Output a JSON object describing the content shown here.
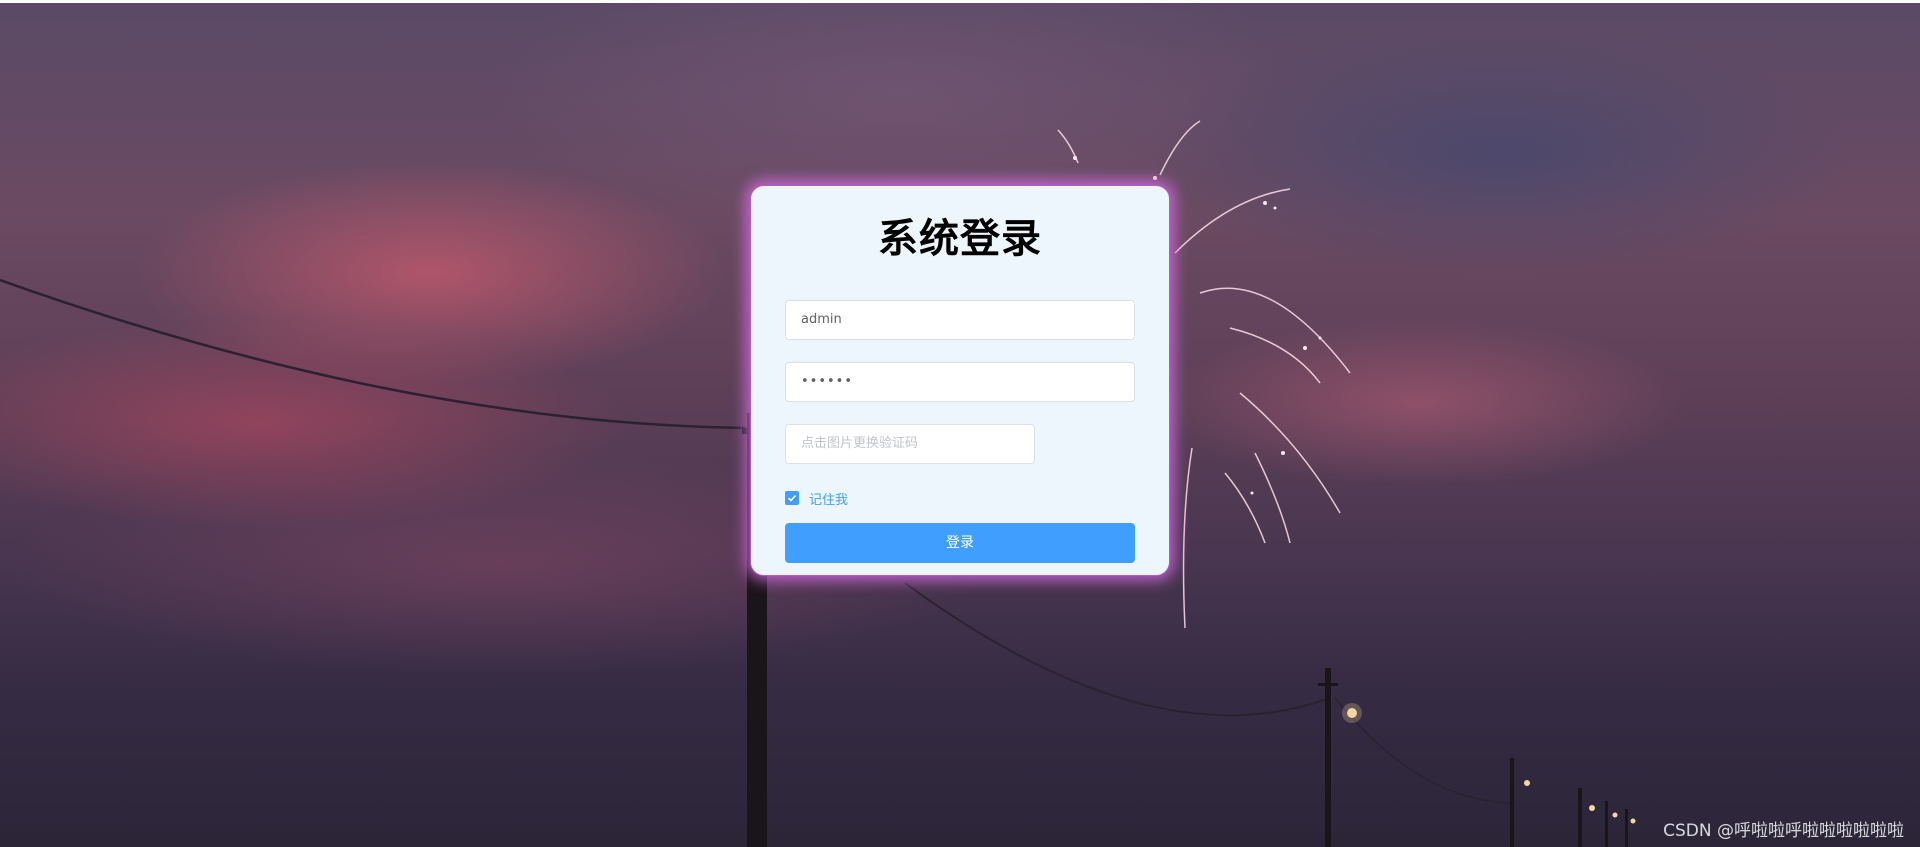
{
  "login": {
    "title": "系统登录",
    "username_value": "admin",
    "password_value": "••••••",
    "captcha_placeholder": "点击图片更换验证码",
    "remember_label": "记住我",
    "remember_checked": true,
    "submit_label": "登录"
  },
  "watermark": "CSDN @呼啦啦呼啦啦啦啦啦啦",
  "colors": {
    "primary": "#409eff",
    "card_background": "#eef6fd",
    "card_glow": "#d86eeb"
  },
  "icons": {
    "checkbox": "check-icon"
  }
}
